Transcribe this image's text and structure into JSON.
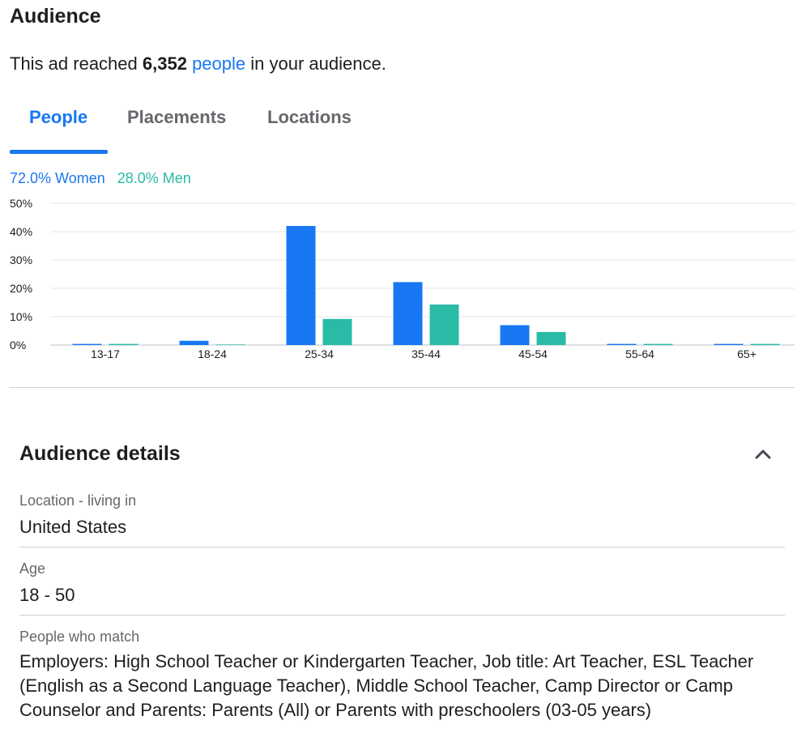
{
  "header": {
    "title": "Audience"
  },
  "reach": {
    "prefix": "This ad reached ",
    "count": "6,352",
    "link": "people",
    "suffix": " in your audience."
  },
  "tabs": [
    {
      "label": "People",
      "active": true
    },
    {
      "label": "Placements",
      "active": false
    },
    {
      "label": "Locations",
      "active": false
    }
  ],
  "gender": {
    "women": "72.0% Women",
    "men": "28.0% Men"
  },
  "colors": {
    "women": "#1877f2",
    "men": "#2abba7",
    "grid": "#e4e6eb",
    "divider": "#ccd0d5"
  },
  "chart_data": {
    "type": "bar",
    "categories": [
      "13-17",
      "18-24",
      "25-34",
      "35-44",
      "45-54",
      "55-64",
      "65+"
    ],
    "series": [
      {
        "name": "Women",
        "values": [
          0.4,
          1.5,
          42.0,
          22.2,
          7.0,
          0.4,
          0.4
        ]
      },
      {
        "name": "Men",
        "values": [
          0.4,
          0.2,
          9.2,
          14.3,
          4.6,
          0.4,
          0.4
        ]
      }
    ],
    "yticks": [
      "0%",
      "10%",
      "20%",
      "30%",
      "40%",
      "50%"
    ],
    "ylim": [
      0,
      50
    ],
    "grid": true,
    "legend": "top-left"
  },
  "details": {
    "title": "Audience details",
    "collapse_icon": "chevron-up-icon",
    "fields": [
      {
        "label": "Location - living in",
        "value": "United States"
      },
      {
        "label": "Age",
        "value": "18 - 50"
      },
      {
        "label": "People who match",
        "value": "Employers: High School Teacher or Kindergarten Teacher, Job title: Art Teacher, ESL Teacher (English as a Second Language Teacher), Middle School Teacher, Camp Director or Camp Counselor and Parents: Parents (All) or Parents with preschoolers (03-05 years)"
      }
    ]
  }
}
